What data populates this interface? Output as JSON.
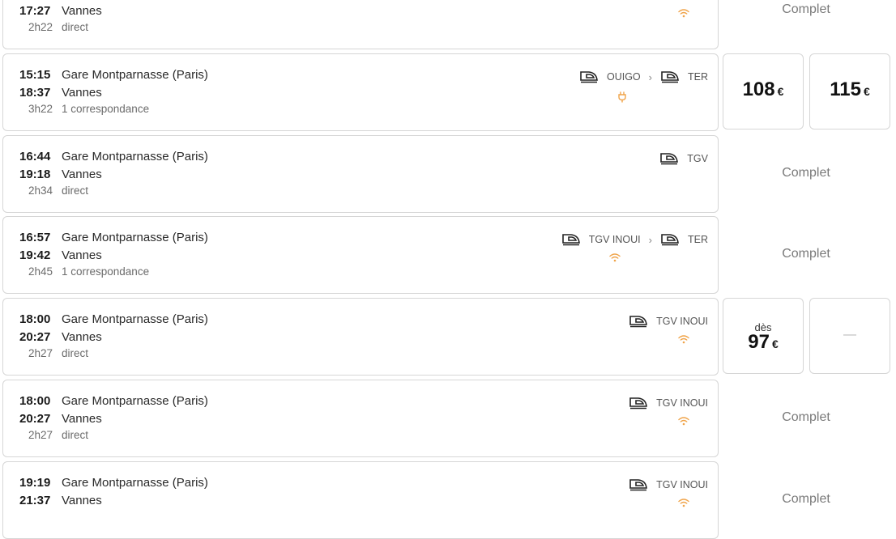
{
  "currency": "€",
  "colors": {
    "wifi": "#f0a44a",
    "plug": "#f0a44a",
    "border": "#d6d6d6"
  },
  "journeys": [
    {
      "dep_time": "",
      "dep_station": "",
      "arr_time": "17:27",
      "arr_station": "Vannes",
      "duration": "2h22",
      "connections": "direct",
      "status": "Complet",
      "amenity": "wifi-icon"
    },
    {
      "dep_time": "15:15",
      "dep_station": "Gare Montparnasse (Paris)",
      "arr_time": "18:37",
      "arr_station": "Vannes",
      "duration": "3h22",
      "connections": "1 correspondance",
      "services": [
        "OUIGO",
        "TER"
      ],
      "amenity": "plug-icon",
      "prices": [
        {
          "prefix": "",
          "amount": "108"
        },
        {
          "prefix": "",
          "amount": "115"
        }
      ]
    },
    {
      "dep_time": "16:44",
      "dep_station": "Gare Montparnasse (Paris)",
      "arr_time": "19:18",
      "arr_station": "Vannes",
      "duration": "2h34",
      "connections": "direct",
      "services": [
        "TGV"
      ],
      "status": "Complet"
    },
    {
      "dep_time": "16:57",
      "dep_station": "Gare Montparnasse (Paris)",
      "arr_time": "19:42",
      "arr_station": "Vannes",
      "duration": "2h45",
      "connections": "1 correspondance",
      "services": [
        "TGV INOUI",
        "TER"
      ],
      "amenity": "wifi-icon",
      "status": "Complet"
    },
    {
      "dep_time": "18:00",
      "dep_station": "Gare Montparnasse (Paris)",
      "arr_time": "20:27",
      "arr_station": "Vannes",
      "duration": "2h27",
      "connections": "direct",
      "services": [
        "TGV INOUI"
      ],
      "amenity": "wifi-icon",
      "prices": [
        {
          "prefix": "dès",
          "amount": "97"
        },
        {
          "prefix": "",
          "amount": "—"
        }
      ]
    },
    {
      "dep_time": "18:00",
      "dep_station": "Gare Montparnasse (Paris)",
      "arr_time": "20:27",
      "arr_station": "Vannes",
      "duration": "2h27",
      "connections": "direct",
      "services": [
        "TGV INOUI"
      ],
      "amenity": "wifi-icon",
      "status": "Complet"
    },
    {
      "dep_time": "19:19",
      "dep_station": "Gare Montparnasse (Paris)",
      "arr_time": "21:37",
      "arr_station": "Vannes",
      "duration": "",
      "connections": "",
      "services": [
        "TGV INOUI"
      ],
      "amenity": "wifi-icon",
      "status": "Complet"
    }
  ]
}
